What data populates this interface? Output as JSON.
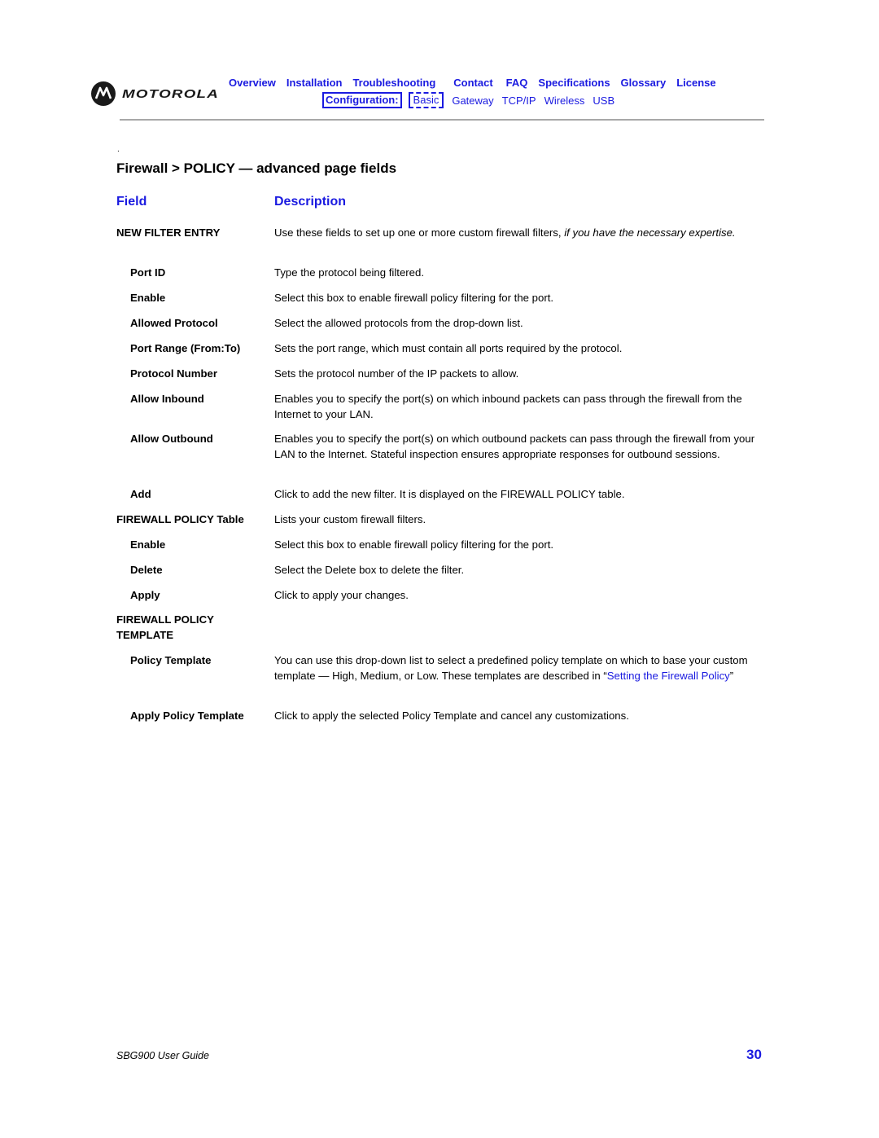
{
  "header": {
    "brand": "MOTOROLA",
    "nav": [
      "Overview",
      "Installation",
      "Troubleshooting",
      "Contact",
      "FAQ",
      "Specifications",
      "Glossary",
      "License"
    ],
    "config_label": "Configuration:",
    "config_active": "Basic",
    "config_links": [
      "Gateway",
      "TCP/IP",
      "Wireless",
      "USB"
    ]
  },
  "page": {
    "dot": ".",
    "title": "Firewall > POLICY — advanced page fields",
    "col_field": "Field",
    "col_description": "Description"
  },
  "rows": [
    {
      "field": "NEW FILTER ENTRY",
      "desc": "Use these fields to set up one or more custom firewall filters, ",
      "desc_em": "if you have the necessary expertise."
    },
    {
      "field": "Port ID",
      "desc": "Type the protocol being filtered."
    },
    {
      "field": "Enable",
      "desc": "Select this box to enable firewall policy filtering for the port."
    },
    {
      "field": "Allowed Protocol",
      "desc": "Select the allowed protocols from the drop-down list."
    },
    {
      "field": "Port Range (From:To)",
      "desc": "Sets the port range, which must contain all ports required by the protocol."
    },
    {
      "field": "Protocol Number",
      "desc": "Sets the protocol number of the IP packets to allow."
    },
    {
      "field": "Allow Inbound",
      "desc": "Enables you to specify the port(s) on which inbound packets can pass through the firewall from the Internet to your LAN."
    },
    {
      "field": "Allow Outbound",
      "desc": "Enables you to specify the port(s) on which outbound packets can pass through the firewall from your LAN to the Internet. Stateful inspection ensures appropriate responses for outbound sessions."
    },
    {
      "field": "Add",
      "desc": "Click to add the new filter. It is displayed on the FIREWALL POLICY table."
    },
    {
      "field": "FIREWALL POLICY Table",
      "desc": "Lists your custom firewall filters."
    },
    {
      "field": "Enable",
      "desc": "Select this box to enable firewall policy filtering for the port."
    },
    {
      "field": "Delete",
      "desc": "Select the Delete box to delete the filter."
    },
    {
      "field": "Apply",
      "desc": "Click to apply your changes."
    },
    {
      "field_line1": "FIREWALL POLICY",
      "field_line2": "TEMPLATE"
    },
    {
      "field": "Policy Template",
      "desc": "You can use this drop-down list to select a predefined policy template on which to base your custom template — High, Medium, or Low. These templates are described in “",
      "link": "Setting the Firewall Policy",
      "desc_after": "”"
    },
    {
      "field": "Apply Policy Template",
      "desc": "Click to apply the selected Policy Template and cancel any customizations."
    }
  ],
  "footer": {
    "guide": "SBG900 User Guide",
    "page_number": "30"
  }
}
